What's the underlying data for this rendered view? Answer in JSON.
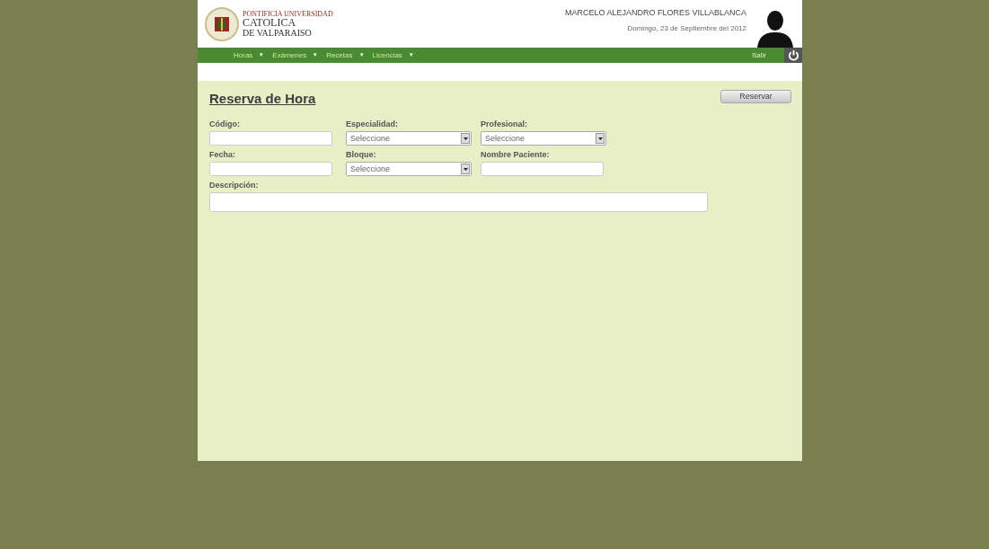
{
  "logo": {
    "line_1": "PONTIFICIA UNIVERSIDAD",
    "line_2": "CATOLICA",
    "line_3": "DE VALPARAISO"
  },
  "user": {
    "name": "MARCELO ALEJANDRO FLORES VILLABLANCA",
    "date": "Domingo, 23 de Septiembre del 2012"
  },
  "nav": {
    "items": [
      {
        "label": "Horas",
        "caret": "▾"
      },
      {
        "label": "Exámenes",
        "caret": "▾"
      },
      {
        "label": "Recetas",
        "caret": "▾"
      },
      {
        "label": "Licencias",
        "caret": "▾"
      }
    ],
    "logout": "Salir"
  },
  "page": {
    "title": "Reserva de Hora",
    "button": "Reservar"
  },
  "fields": [
    {
      "kind": "text",
      "label": "Código:"
    },
    {
      "kind": "select",
      "label": "Especialidad:",
      "value": "Seleccione"
    },
    {
      "kind": "select",
      "label": "Profesional:",
      "value": "Seleccione"
    },
    {
      "kind": "text",
      "label": "Fecha:"
    },
    {
      "kind": "select",
      "label": "Bloque:",
      "value": "Seleccione"
    },
    {
      "kind": "text",
      "label": "Nombre Paciente:"
    }
  ],
  "description": {
    "label": "Descripción:"
  }
}
